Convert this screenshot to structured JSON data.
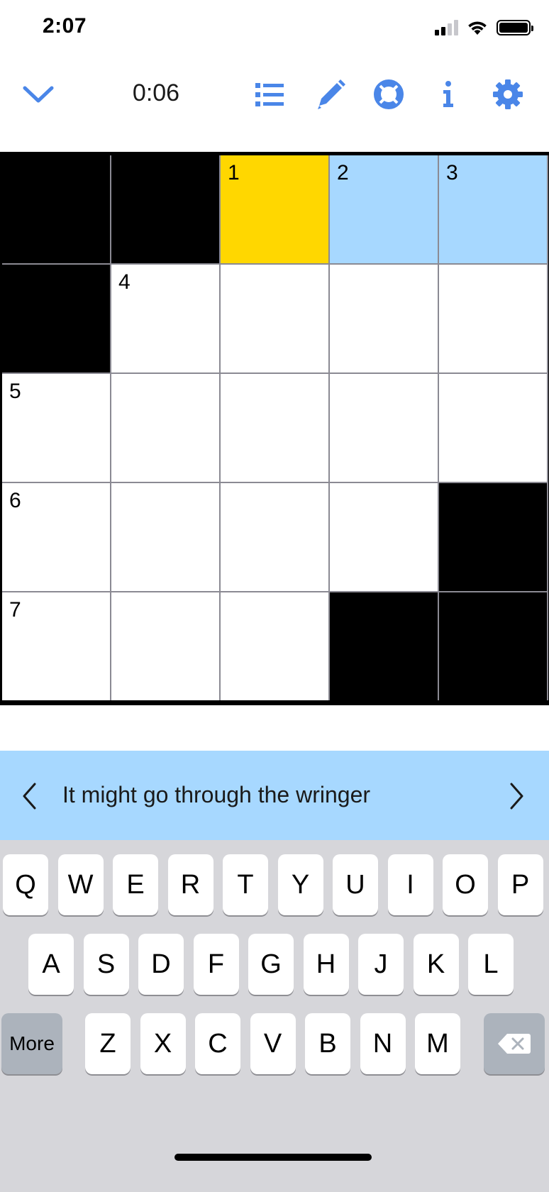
{
  "status_bar": {
    "time": "2:07"
  },
  "toolbar": {
    "timer": "0:06",
    "icons": [
      "chevron-down-icon",
      "list-icon",
      "pencil-icon",
      "lifebuoy-icon",
      "info-icon",
      "gear-icon"
    ]
  },
  "colors": {
    "accent": "#4a86e8",
    "active_cell": "#ffd700",
    "word_highlight": "#a7d8ff",
    "block": "#000000",
    "keyboard_bg": "#d6d6da",
    "function_key": "#acb3bc"
  },
  "grid": {
    "rows": 5,
    "cols": 5,
    "cells": [
      [
        {
          "type": "block"
        },
        {
          "type": "block"
        },
        {
          "type": "active",
          "num": "1"
        },
        {
          "type": "word",
          "num": "2"
        },
        {
          "type": "word",
          "num": "3"
        }
      ],
      [
        {
          "type": "block"
        },
        {
          "type": "open",
          "num": "4"
        },
        {
          "type": "open"
        },
        {
          "type": "open"
        },
        {
          "type": "open"
        }
      ],
      [
        {
          "type": "open",
          "num": "5"
        },
        {
          "type": "open"
        },
        {
          "type": "open"
        },
        {
          "type": "open"
        },
        {
          "type": "open"
        }
      ],
      [
        {
          "type": "open",
          "num": "6"
        },
        {
          "type": "open"
        },
        {
          "type": "open"
        },
        {
          "type": "open"
        },
        {
          "type": "block"
        }
      ],
      [
        {
          "type": "open",
          "num": "7"
        },
        {
          "type": "open"
        },
        {
          "type": "open"
        },
        {
          "type": "block"
        },
        {
          "type": "block"
        }
      ]
    ]
  },
  "clue": {
    "text": "It might go through the wringer"
  },
  "keyboard": {
    "row1": [
      "Q",
      "W",
      "E",
      "R",
      "T",
      "Y",
      "U",
      "I",
      "O",
      "P"
    ],
    "row2": [
      "A",
      "S",
      "D",
      "F",
      "G",
      "H",
      "J",
      "K",
      "L"
    ],
    "row3": [
      "Z",
      "X",
      "C",
      "V",
      "B",
      "N",
      "M"
    ],
    "more_label": "More",
    "backspace_icon": "backspace-icon"
  }
}
